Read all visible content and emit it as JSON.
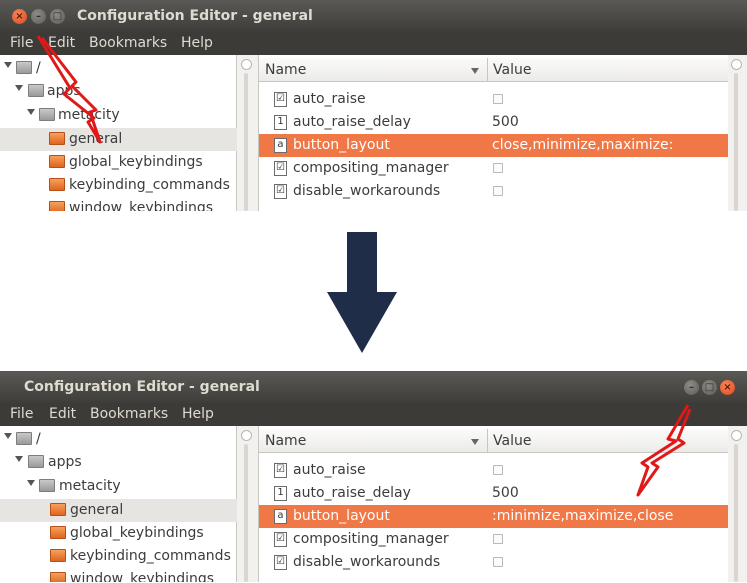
{
  "app_title": "Configuration Editor - general",
  "menu": [
    "File",
    "Edit",
    "Bookmarks",
    "Help"
  ],
  "tree": [
    {
      "label": "/",
      "icon": "folder-gray-icon"
    },
    {
      "label": "apps",
      "icon": "folder-gray-icon"
    },
    {
      "label": "metacity",
      "icon": "folder-gray-icon"
    },
    {
      "label": "general",
      "icon": "folder-orange-icon",
      "selected": true
    },
    {
      "label": "global_keybindings",
      "icon": "folder-orange-icon"
    },
    {
      "label": "keybinding_commands",
      "icon": "folder-orange-icon"
    },
    {
      "label": "window_keybindings",
      "icon": "folder-orange-icon"
    }
  ],
  "columns": {
    "name": "Name",
    "value": "Value"
  },
  "rows_common": [
    {
      "name": "auto_raise",
      "type": "bool",
      "value": ""
    },
    {
      "name": "auto_raise_delay",
      "type": "int",
      "value": "500"
    },
    {
      "name": "button_layout",
      "type": "string",
      "selected": true
    },
    {
      "name": "compositing_manager",
      "type": "bool",
      "value": ""
    },
    {
      "name": "disable_workarounds",
      "type": "bool",
      "value": ""
    }
  ],
  "before": {
    "button_layout_value": "close,minimize,maximize:"
  },
  "after": {
    "button_layout_value": ":minimize,maximize,close"
  },
  "colors": {
    "accent": "#f07746",
    "titlebar": "#3c3b37",
    "annotation": "#e01818",
    "arrow": "#1f2d48"
  }
}
